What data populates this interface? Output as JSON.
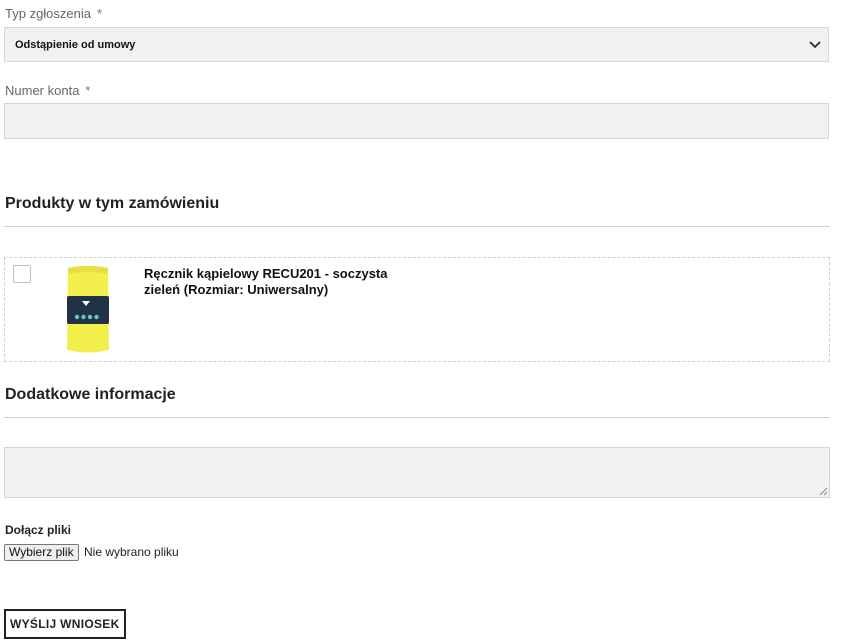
{
  "form": {
    "request_type": {
      "label": "Typ zgłoszenia",
      "required_mark": "*",
      "selected": "Odstąpienie od umowy"
    },
    "account_number": {
      "label": "Numer konta",
      "required_mark": "*",
      "value": ""
    }
  },
  "products": {
    "heading": "Produkty w tym zamówieniu",
    "items": [
      {
        "name": "Ręcznik kąpielowy RECU201 - soczysta zieleń (Rozmiar: Uniwersalny)",
        "checked": false
      }
    ]
  },
  "additional": {
    "heading": "Dodatkowe informacje",
    "value": ""
  },
  "attachments": {
    "label": "Dołącz pliki",
    "button": "Wybierz plik",
    "status": "Nie wybrano pliku"
  },
  "submit": {
    "label": "WYŚLIJ WNIOSEK"
  },
  "colors": {
    "field_bg": "#f1f1f1",
    "field_border": "#d6d6d6",
    "product_color": "#f2ef4d"
  }
}
